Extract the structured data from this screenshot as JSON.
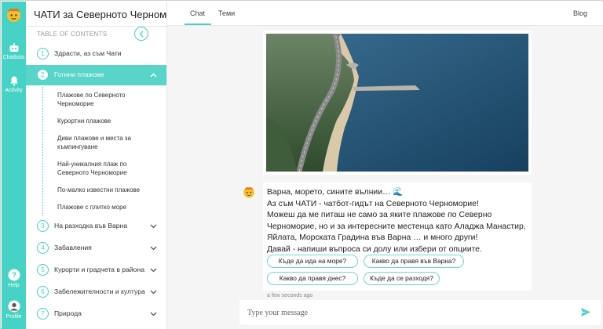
{
  "app": {
    "title": "ЧАТИ за Северното Черноморие"
  },
  "rail": {
    "chatbots": "Chatbots",
    "activity": "Activity",
    "help": "Help",
    "profile": "Profile"
  },
  "toc": {
    "label": "TABLE OF CONTENTS",
    "sections": [
      {
        "num": "1",
        "label": "Здрасти, аз съм Чати"
      },
      {
        "num": "2",
        "label": "Готини плажове"
      },
      {
        "num": "3",
        "label": "На разходка във Варна"
      },
      {
        "num": "4",
        "label": "Забавления"
      },
      {
        "num": "5",
        "label": "Курорти и градчета в района"
      },
      {
        "num": "6",
        "label": "Забележителности и култура"
      },
      {
        "num": "7",
        "label": "Природа"
      }
    ],
    "subitems": [
      {
        "line1": "Плажове по Северното",
        "line2": "Черноморие"
      },
      {
        "line1": "Курортни плажове",
        "line2": ""
      },
      {
        "line1": "Диви плажове и места за",
        "line2": "къмпингуване"
      },
      {
        "line1": "Най-уникалния плаж по",
        "line2": "Северното Черноморие"
      },
      {
        "line1": "По-малко известни плажове",
        "line2": ""
      },
      {
        "line1": "Плажове с плитко море",
        "line2": ""
      }
    ]
  },
  "tabs": {
    "chat": "Chat",
    "topics": "Теми",
    "blog": "Blog"
  },
  "message": {
    "lines": [
      "Варна, морето, сините вълнии… 🌊",
      "Аз съм ЧАТИ - чатбот-гидът на Северното Черноморие!",
      "Можеш да ме питаш не само за яките плажове по Северно",
      "Черноморие, но и за интересните местенца като Аладжа Манастир,",
      "Яйлата, Морската Градина във Варна … и много други!",
      "Давай - напиши въпроса си долу или избери от опциите."
    ],
    "chips": [
      "Къде да ида на море?",
      "Какво да правя във Варна?",
      "Какво да правя днес?",
      "Къде да се разходя?"
    ],
    "time": "a few seconds ago"
  },
  "input": {
    "placeholder": "Type your message"
  },
  "colors": {
    "accent": "#46d2c4",
    "active_row": "#58d5c8"
  }
}
